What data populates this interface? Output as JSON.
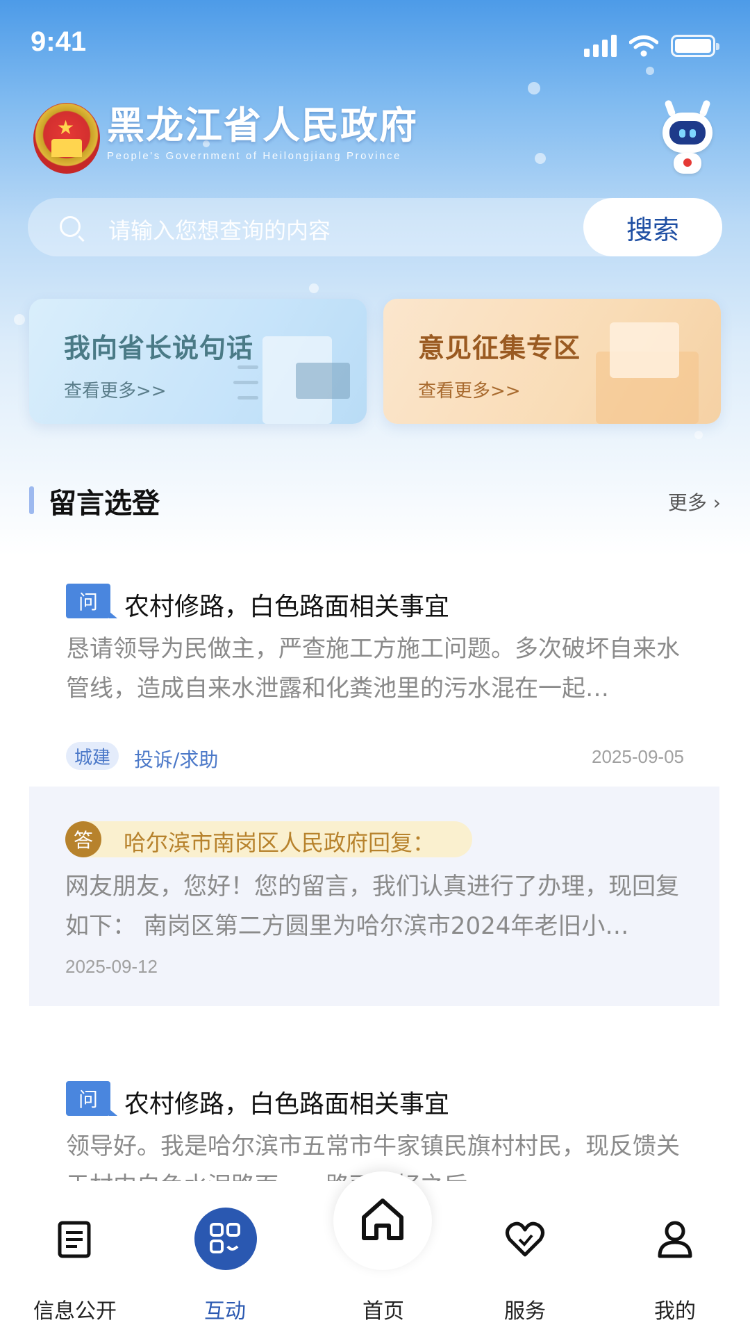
{
  "status_bar": {
    "time": "9:41"
  },
  "header": {
    "title": "黑龙江省人民政府",
    "subtitle": "People's Government of Heilongjiang Province"
  },
  "search": {
    "placeholder": "请输入您想查询的内容",
    "button_label": "搜索"
  },
  "feature_cards": [
    {
      "title": "我向省长说句话",
      "more": "查看更多>>"
    },
    {
      "title": "意见征集专区",
      "more": "查看更多>>"
    }
  ],
  "section": {
    "title": "留言选登",
    "more": "更多 ›"
  },
  "messages": [
    {
      "badge": "问",
      "title": "农村修路，白色路面相关事宜",
      "body": "恳请领导为民做主，严查施工方施工问题。多次破坏自来水管线，造成自来水泄露和化粪池里的污水混在一起…",
      "tag": "城建",
      "type": "投诉/求助",
      "date": "2025-09-05"
    },
    {
      "badge": "问",
      "title": "农村修路，白色路面相关事宜",
      "body": "领导好。我是哈尔滨市五常市牛家镇民旗村村民，现反馈关于村内白色水泥路面……路面修好之后，…"
    }
  ],
  "answer": {
    "badge": "答",
    "org": "哈尔滨市南岗区人民政府回复：",
    "body": "网友朋友，您好！您的留言，我们认真进行了办理，现回复如下： 南岗区第二方圆里为哈尔滨市2024年老旧小…",
    "date": "2025-09-12"
  },
  "tabs": [
    {
      "label": "信息公开",
      "icon": "document-icon"
    },
    {
      "label": "互动",
      "icon": "interaction-icon",
      "active": true
    },
    {
      "label": "首页",
      "icon": "home-icon"
    },
    {
      "label": "服务",
      "icon": "heart-icon"
    },
    {
      "label": "我的",
      "icon": "user-icon"
    }
  ],
  "colors": {
    "primary": "#2a58b1",
    "question_badge": "#4a86de",
    "answer_badge": "#b7822c",
    "tag_text": "#4b78c8"
  }
}
